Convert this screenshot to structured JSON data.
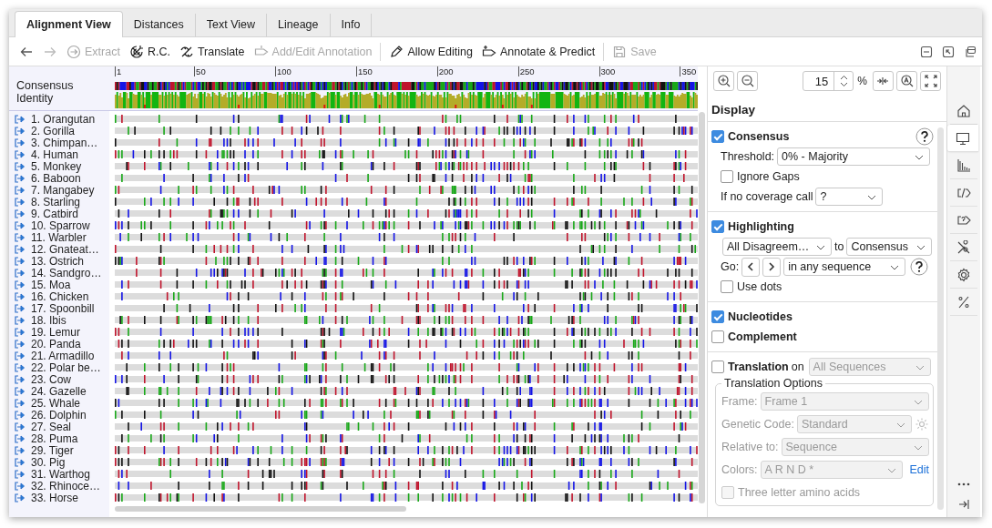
{
  "tabs": [
    {
      "label": "Alignment View",
      "selected": true
    },
    {
      "label": "Distances",
      "selected": false
    },
    {
      "label": "Text View",
      "selected": false
    },
    {
      "label": "Lineage",
      "selected": false
    },
    {
      "label": "Info",
      "selected": false
    }
  ],
  "toolbar": {
    "nav": [
      {
        "disabled": false
      },
      {
        "disabled": true
      }
    ],
    "items": [
      {
        "label": "Extract",
        "disabled": true
      },
      {
        "label": "R.C.",
        "disabled": false
      },
      {
        "label": "Translate",
        "disabled": false
      },
      {
        "label": "Add/Edit Annotation",
        "disabled": true
      },
      {
        "label": "Allow Editing",
        "disabled": false
      },
      {
        "label": "Annotate & Predict",
        "disabled": false
      },
      {
        "label": "Save",
        "disabled": true
      }
    ]
  },
  "ruler": [
    "1",
    "50",
    "100",
    "150",
    "200",
    "250",
    "300",
    "350"
  ],
  "header_labels": [
    "Consensus",
    "Identity"
  ],
  "sequences": [
    "1. Orangutan",
    "2. Gorilla",
    "3. Chimpan…",
    "4. Human",
    "5. Monkey",
    "6. Baboon",
    "7. Mangabey",
    "8. Starling",
    "9. Catbird",
    "10. Sparrow",
    "11. Warbler",
    "12. Gnateat…",
    "13. Ostrich",
    "14. Sandgro…",
    "15. Moa",
    "16. Chicken",
    "17. Spoonbill",
    "18. Ibis",
    "19. Lemur",
    "20. Panda",
    "21. Armadillo",
    "22. Polar be…",
    "23. Cow",
    "24. Gazelle",
    "25. Whale",
    "26. Dolphin",
    "27. Seal",
    "28. Puma",
    "29. Tiger",
    "30. Pig",
    "31. Warthog",
    "32. Rhinoce…",
    "33. Horse"
  ],
  "zoom": {
    "value": "15",
    "unit": "%"
  },
  "panel": {
    "title": "Display",
    "consensus": {
      "label": "Consensus",
      "checked": true,
      "threshold_label": "Threshold:",
      "threshold": "0% - Majority",
      "ignore_gaps": {
        "label": "Ignore Gaps",
        "checked": false
      },
      "coverage_label": "If no coverage call",
      "coverage": "?"
    },
    "highlighting": {
      "label": "Highlighting",
      "checked": true,
      "mode": "All Disagreem…",
      "to": "to",
      "target": "Consensus",
      "go": "Go:",
      "scope": "in any sequence",
      "use_dots": {
        "label": "Use dots",
        "checked": false
      }
    },
    "nucleotides": {
      "label": "Nucleotides",
      "checked": true
    },
    "complement": {
      "label": "Complement",
      "checked": false
    },
    "translation": {
      "label": "Translation",
      "checked": false,
      "on": "on",
      "target": "All Sequences",
      "options_title": "Translation Options",
      "fields": [
        {
          "label": "Frame:",
          "value": "Frame 1",
          "kind": "plain"
        },
        {
          "label": "Genetic Code:",
          "value": "Standard",
          "kind": "gear"
        },
        {
          "label": "Relative to:",
          "value": "Sequence",
          "kind": "plain"
        },
        {
          "label": "Colors:",
          "value": "A R N D *",
          "kind": "edit",
          "link": "Edit"
        }
      ],
      "three_letter": {
        "label": "Three letter amino acids",
        "checked": false
      }
    }
  },
  "sidebar": [
    {
      "selected": false
    },
    {
      "selected": true
    },
    {
      "selected": false
    },
    {
      "selected": false
    },
    {
      "selected": false
    },
    {
      "selected": false
    },
    {
      "selected": false
    },
    {
      "selected": false
    }
  ]
}
